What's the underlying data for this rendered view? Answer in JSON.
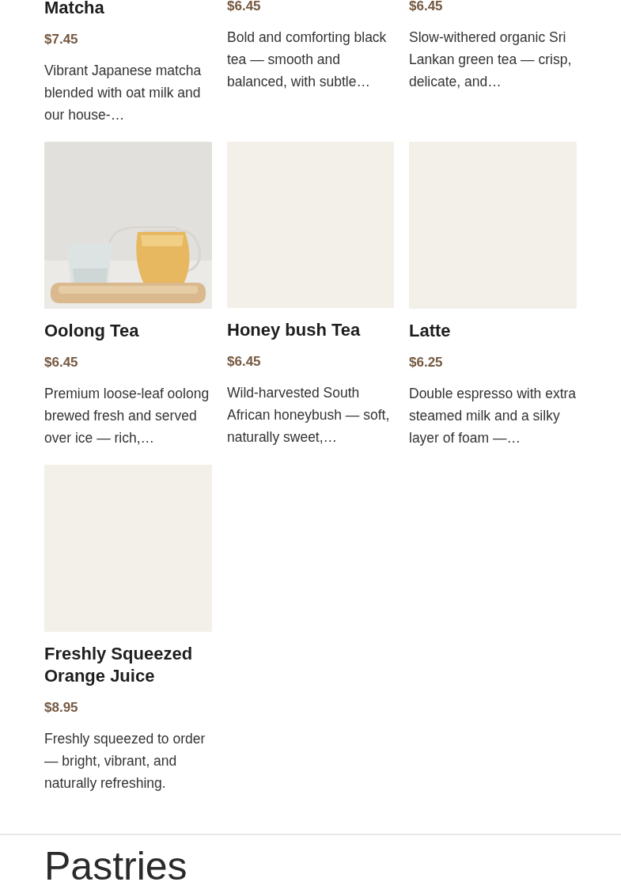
{
  "drinks": [
    {
      "kind": "text",
      "title": "Matcha",
      "price": "$7.45",
      "description": "Vibrant Japanese matcha blended with oat milk and our house-…"
    },
    {
      "kind": "text",
      "price": "$6.45",
      "description": "Bold and comforting black tea — smooth and balanced, with subtle…"
    },
    {
      "kind": "text",
      "price": "$6.45",
      "description": "Slow-withered organic Sri Lankan green tea — crisp, delicate, and…"
    },
    {
      "title": "Oolong Tea",
      "price": "$6.45",
      "description": "Premium loose-leaf oolong brewed fresh and served over ice — rich,…"
    },
    {
      "kind": "placeholder",
      "title": "Honey bush Tea",
      "price": "$6.45",
      "description": "Wild-harvested South African honeybush — soft, naturally sweet,…"
    },
    {
      "kind": "placeholder",
      "title": "Latte",
      "price": "$6.25",
      "description": "Double espresso with extra steamed milk and a silky layer of foam —…"
    },
    {
      "kind": "placeholder",
      "title": "Freshly Squeezed Orange Juice",
      "price": "$8.95",
      "description": "Freshly squeezed to order — bright, vibrant, and naturally refreshing."
    }
  ],
  "next_section": {
    "heading": "Pastries"
  }
}
